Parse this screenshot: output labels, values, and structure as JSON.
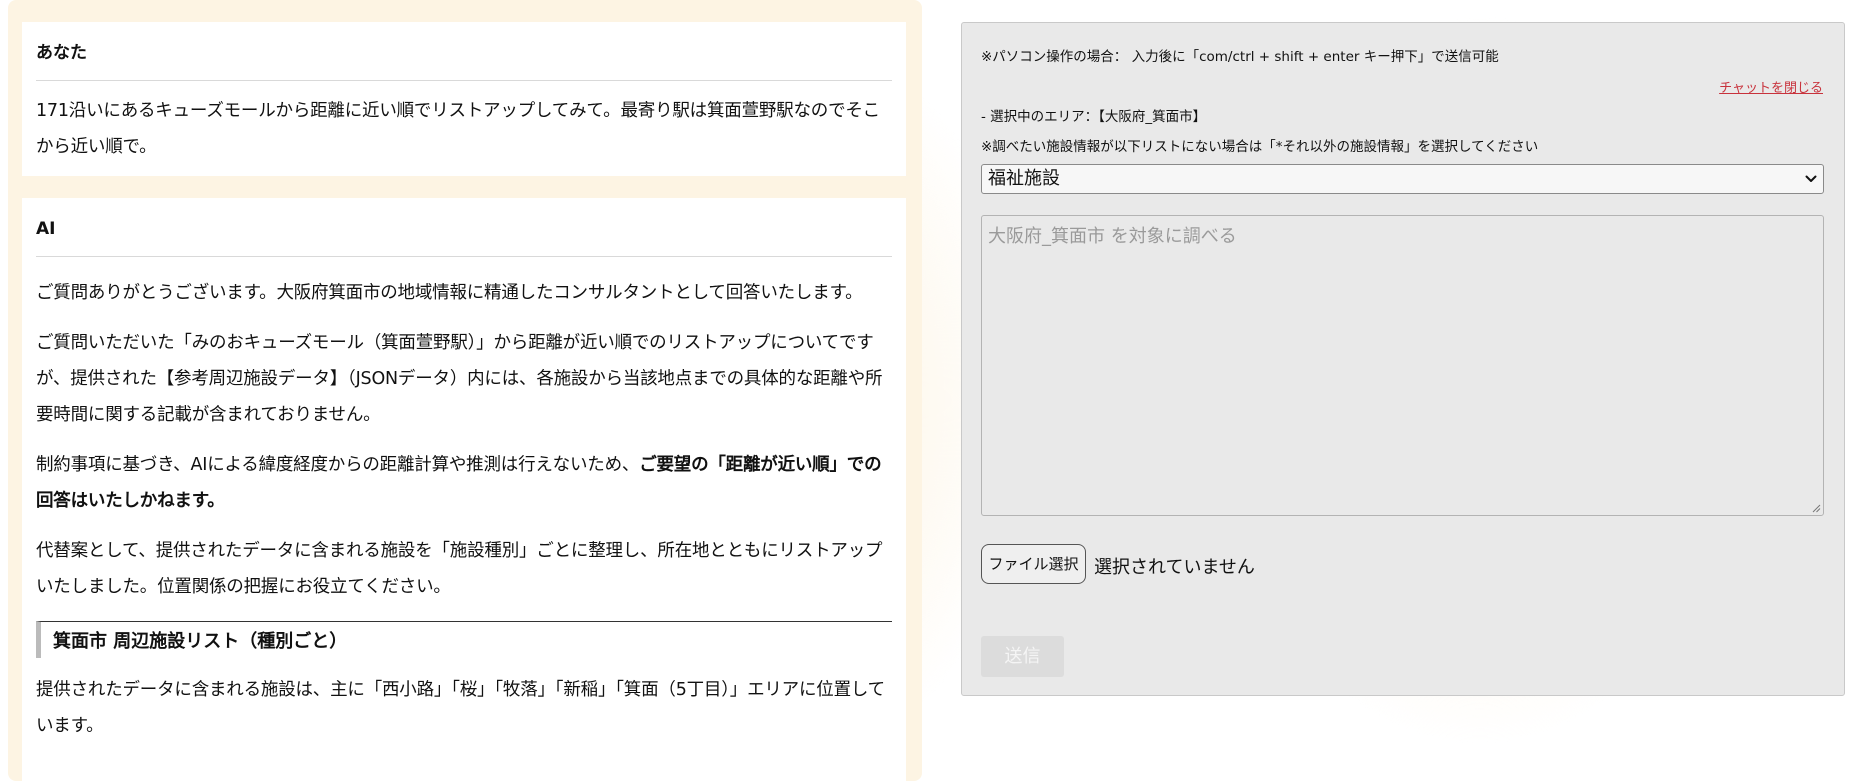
{
  "chat": {
    "user_message": {
      "role_label": "あなた",
      "text": "171沿いにあるキューズモールから距離に近い順でリストアップしてみて。最寄り駅は箕面萱野駅なのでそこから近い順で。"
    },
    "ai_message": {
      "role_label": "AI",
      "para1": "ご質問ありがとうございます。大阪府箕面市の地域情報に精通したコンサルタントとして回答いたします。",
      "para2": "ご質問いただいた「みのおキューズモール（箕面萱野駅）」から距離が近い順でのリストアップについてですが、提供された【参考周辺施設データ】（JSONデータ）内には、各施設から当該地点までの具体的な距離や所要時間に関する記載が含まれておりません。",
      "para3_plain": "制約事項に基づき、AIによる緯度経度からの距離計算や推測は行えないため、",
      "para3_bold": "ご要望の「距離が近い順」での回答はいたしかねます。",
      "para4": "代替案として、提供されたデータに含まれる施設を「施設種別」ごとに整理し、所在地とともにリストアップいたしました。位置関係の把握にお役立てください。",
      "section_heading": "箕面市 周辺施設リスト（種別ごと）",
      "para5": "提供されたデータに含まれる施設は、主に「西小路」「桜」「牧落」「新稲」「箕面（5丁目）」エリアに位置しています。"
    }
  },
  "panel": {
    "top_note": "※パソコン操作の場合： 入力後に「com/ctrl + shift + enter キー押下」で送信可能",
    "close_link": "チャットを閉じる",
    "selected_area": "- 選択中のエリア：【大阪府_箕面市】",
    "facility_note": "※調べたい施設情報が以下リストにない場合は「*それ以外の施設情報」を選択してください",
    "facility_select": {
      "selected": "福祉施設"
    },
    "query": {
      "value": "",
      "placeholder": "大阪府_箕面市 を対象に調べる"
    },
    "file": {
      "button_label": "ファイル選択",
      "status": "選択されていません"
    },
    "send_label": "送信"
  },
  "icons": {
    "select_arrow": "chevron-down-icon",
    "textarea_resize": "resize-grip-icon"
  }
}
